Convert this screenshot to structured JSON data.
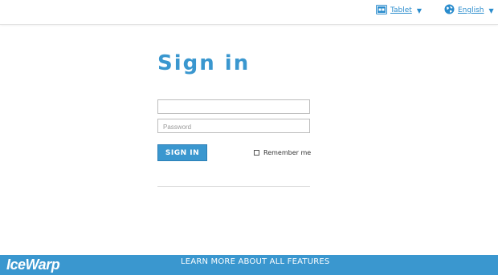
{
  "header": {
    "view_mode_label": "Tablet",
    "view_mode_icon": "tablet-icon",
    "language_label": "English",
    "language_icon": "globe-icon"
  },
  "login": {
    "title": "Sign in",
    "username_value": "",
    "username_placeholder": "",
    "password_placeholder": "Password",
    "sign_in_label": "SIGN IN",
    "remember_me_label": "Remember me",
    "remember_me_checked": false
  },
  "footer": {
    "logo_text": "IceWarp",
    "learn_more_label": "LEARN MORE ABOUT ALL FEATURES"
  },
  "colors": {
    "accent": "#3a97cf",
    "link": "#2a8ccd"
  }
}
